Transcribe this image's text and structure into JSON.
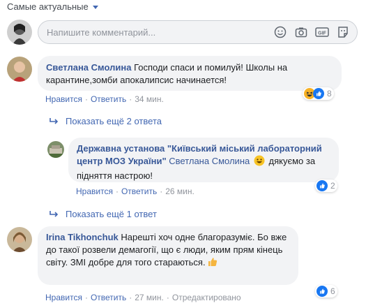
{
  "sort": {
    "label": "Самые актуальные"
  },
  "composer": {
    "placeholder": "Напишите комментарий..."
  },
  "comments": [
    {
      "author": "Светлана Смолина",
      "text": "Господи спаси и помилуй! Школы на карантине,зомби апокалипсис начинается!",
      "like": "Нравится",
      "reply": "Ответить",
      "time": "34 мин.",
      "reactions_count": "8",
      "reactions": [
        "haha",
        "like"
      ]
    },
    {
      "author": "Державна установа \"Київський міський лабораторний центр МОЗ України\"",
      "mention": "Светлана Смолина",
      "text": "дякуємо за підняття настрою!",
      "like": "Нравится",
      "reply": "Ответить",
      "time": "26 мин.",
      "reactions_count": "2",
      "reactions": [
        "like"
      ]
    },
    {
      "author": "Irina Tikhonchuk",
      "text": "Нарешті хоч одне благоразуміє. Бо вже до такої розвели демагогії, що є люди, яким прям кінець світу. ЗМІ добре для того стараються.",
      "like": "Нравится",
      "reply": "Ответить",
      "time": "27 мин.",
      "edited": "Отредактировано",
      "reactions_count": "6",
      "reactions": [
        "like"
      ]
    }
  ],
  "more_replies": [
    "Показать ещё 2 ответа",
    "Показать ещё 1 ответ"
  ],
  "colors": {
    "link": "#4267b2",
    "author": "#385898",
    "bubble": "#f2f3f5",
    "like": "#1877f2",
    "haha": "#f7b125"
  }
}
